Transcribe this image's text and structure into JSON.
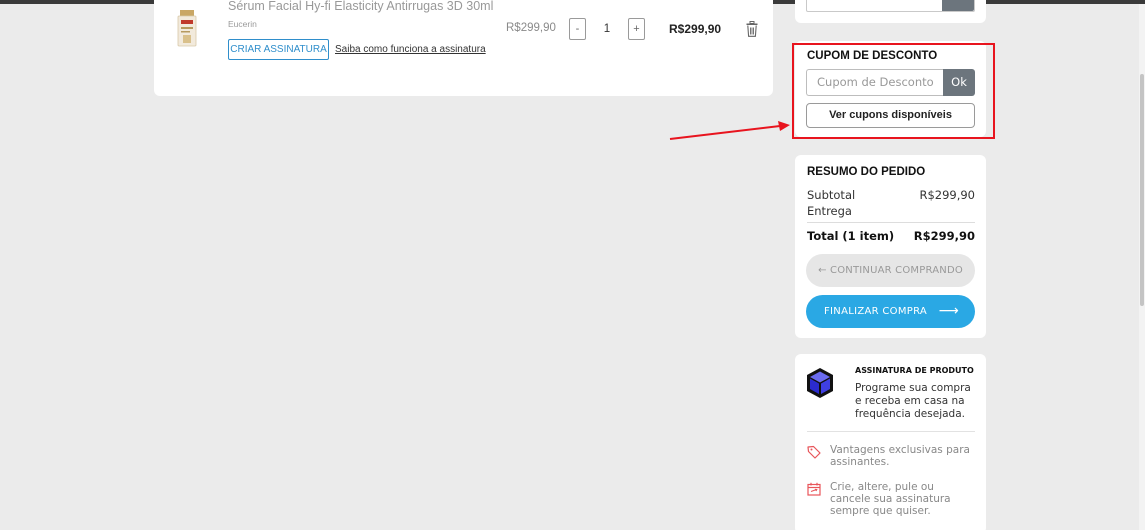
{
  "cart_item": {
    "name": "Sérum Facial Hy-fi Elasticity Antirrugas 3D 30ml",
    "brand": "Eucerin",
    "subscribe_button": "CRIAR ASSINATURA",
    "subscribe_link": "Saiba como funciona a assinatura",
    "unit_price": "R$299,90",
    "qty_minus": "-",
    "quantity": "1",
    "qty_plus": "+",
    "line_total": "R$299,90"
  },
  "coupon": {
    "title": "CUPOM DE DESCONTO",
    "placeholder": "Cupom de Desconto",
    "ok_label": "Ok",
    "view_button": "Ver cupons disponíveis"
  },
  "summary": {
    "title": "RESUMO DO PEDIDO",
    "subtotal_label": "Subtotal",
    "subtotal_value": "R$299,90",
    "delivery_label": "Entrega",
    "total_label": "Total (1 item)",
    "total_value": "R$299,90",
    "continue_button": "← CONTINUAR COMPRANDO",
    "finish_button": "FINALIZAR COMPRA",
    "finish_arrow": "⟶"
  },
  "subscription": {
    "title": "ASSINATURA DE PRODUTO",
    "description": "Programe sua compra e receba em casa na frequência desejada.",
    "benefit_1": "Vantagens exclusivas para assinantes.",
    "benefit_2": "Crie, altere, pule ou cancele sua assinatura sempre que quiser."
  },
  "colors": {
    "accent_blue": "#2aa8e4",
    "highlight_red": "#e8141e",
    "button_gray": "#6c757d",
    "benefit_icon": "#e8555a"
  },
  "icons": [
    "product-image",
    "trash-icon",
    "box-3d-icon",
    "tag-icon",
    "calendar-icon",
    "arrow-left-icon",
    "arrow-right-icon"
  ]
}
